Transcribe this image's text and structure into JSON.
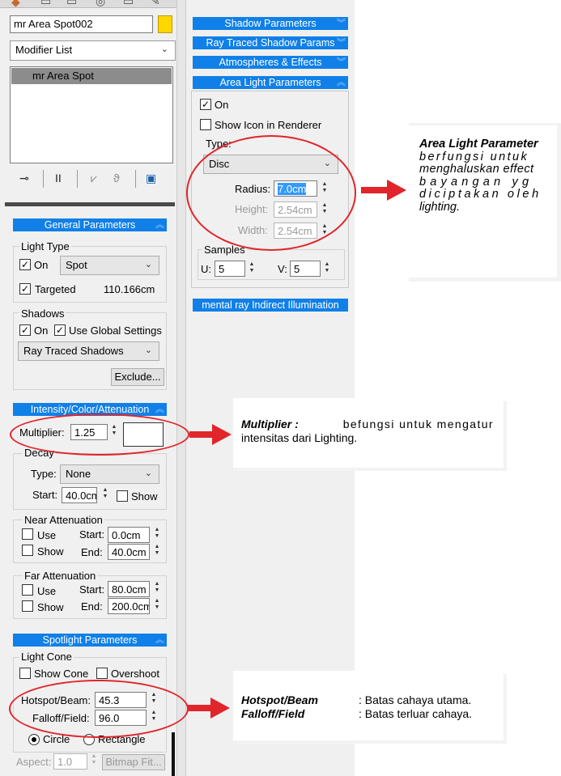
{
  "object_name": "mr Area Spot002",
  "object_color": "#ffd700",
  "modifier_list": "Modifier List",
  "stack_item": "mr Area Spot",
  "right_rollouts": {
    "shadow_params": "Shadow Parameters",
    "raytraced_params": "Ray Traced Shadow Params",
    "atmospheres": "Atmospheres & Effects",
    "area_light": "Area Light Parameters",
    "indirect": "mental ray Indirect Illumination"
  },
  "area_light": {
    "on_label": "On",
    "show_icon_label": "Show Icon in Renderer",
    "type_label": "Type:",
    "type_value": "Disc",
    "radius_label": "Radius:",
    "radius_value": "7.0cm",
    "height_label": "Height:",
    "height_value": "2.54cm",
    "width_label": "Width:",
    "width_value": "2.54cm",
    "samples_label": "Samples",
    "u_label": "U:",
    "u_value": "5",
    "v_label": "V:",
    "v_value": "5"
  },
  "general": {
    "title": "General Parameters",
    "light_type_label": "Light Type",
    "on_label": "On",
    "type_value": "Spot",
    "targeted_label": "Targeted",
    "target_distance": "110.166cm",
    "shadows_label": "Shadows",
    "shadows_on_label": "On",
    "global_label": "Use Global Settings",
    "shadow_type": "Ray Traced Shadows",
    "exclude_label": "Exclude..."
  },
  "intensity": {
    "title": "Intensity/Color/Attenuation",
    "multiplier_label": "Multiplier:",
    "multiplier_value": "1.25",
    "decay_label": "Decay",
    "type_label": "Type:",
    "type_value": "None",
    "start_label": "Start:",
    "start_value": "40.0cm",
    "show_label": "Show",
    "near_label": "Near Attenuation",
    "near_use": "Use",
    "near_show": "Show",
    "near_start_label": "Start:",
    "near_start_value": "0.0cm",
    "near_end_label": "End:",
    "near_end_value": "40.0cm",
    "far_label": "Far Attenuation",
    "far_use": "Use",
    "far_show": "Show",
    "far_start_label": "Start:",
    "far_start_value": "80.0cm",
    "far_end_label": "End:",
    "far_end_value": "200.0cm"
  },
  "spotlight": {
    "title": "Spotlight Parameters",
    "light_cone_label": "Light Cone",
    "show_cone_label": "Show Cone",
    "overshoot_label": "Overshoot",
    "hotspot_label": "Hotspot/Beam:",
    "hotspot_value": "45.3",
    "falloff_label": "Falloff/Field:",
    "falloff_value": "96.0",
    "circle_label": "Circle",
    "rectangle_label": "Rectangle",
    "aspect_label": "Aspect:",
    "aspect_value": "1.0",
    "bitmap_label": "Bitmap Fit..."
  },
  "notes": {
    "area_title": "Area Light Parameter",
    "area_l1": "berfungsi untuk",
    "area_l2": "menghaluskan effect",
    "area_l3": "bayangan yg",
    "area_l4": "diciptakan oleh",
    "area_l5": "lighting.",
    "mult_title": "Multiplier :",
    "mult_l1": "befungsi untuk mengatur",
    "mult_l2": "intensitas dari Lighting.",
    "hot_title": "Hotspot/Beam",
    "hot_desc": ": Batas cahaya utama.",
    "fall_title": "Falloff/Field",
    "fall_desc": ": Batas terluar cahaya."
  },
  "accent_color": "#1080e8",
  "annotation_color": "#e0252b"
}
